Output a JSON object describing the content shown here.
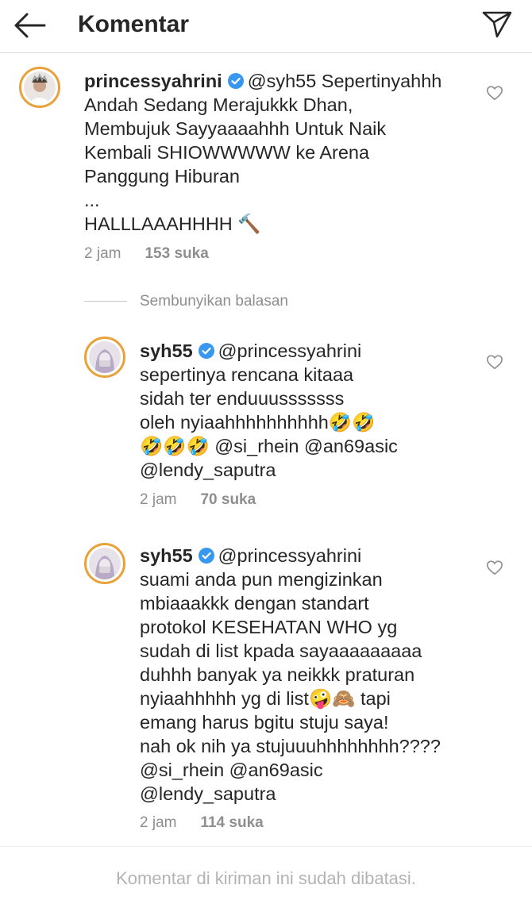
{
  "header": {
    "title": "Komentar",
    "back_icon": "arrow-left-icon",
    "share_icon": "paper-plane-icon"
  },
  "comments": [
    {
      "username": "princessyahrini",
      "verified": true,
      "lines": [
        "@syh55 Sepertinyahhh",
        "Andah Sedang Merajukkk Dhan,",
        "Membujuk Sayyaaaahhh Untuk Naik",
        "Kembali SHIOWWWWW ke Arena",
        "Panggung Hiburan",
        "...",
        "HALLLAAAHHHH 🔨"
      ],
      "time": "2 jam",
      "likes": "153 suka"
    }
  ],
  "hide_replies": {
    "label": "Sembunyikan balasan"
  },
  "replies": [
    {
      "username": "syh55",
      "verified": true,
      "lines": [
        "@princessyahrini",
        "sepertinya rencana kitaaa",
        "sidah ter enduuusssssss",
        "oleh nyiaahhhhhhhhhh🤣🤣",
        "🤣🤣🤣 @si_rhein @an69asic",
        "@lendy_saputra"
      ],
      "time": "2 jam",
      "likes": "70 suka"
    },
    {
      "username": "syh55",
      "verified": true,
      "lines": [
        "@princessyahrini",
        "suami anda pun mengizinkan",
        "mbiaaakkk dengan standart",
        "protokol KESEHATAN WHO yg",
        "sudah di list kpada sayaaaaaaaaa",
        "duhhh banyak ya neikkk praturan",
        "nyiaahhhhh yg di list🤪🙈 tapi",
        "emang harus bgitu stuju saya!",
        "nah ok nih ya stujuuuhhhhhhhh????",
        "@si_rhein @an69asic",
        "@lendy_saputra"
      ],
      "time": "2 jam",
      "likes": "114 suka"
    }
  ],
  "footer": {
    "text": "Komentar di kiriman ini sudah dibatasi."
  },
  "colors": {
    "avatar_ring": "#e8a23a",
    "verified_badge": "#3897f0",
    "muted_text": "#8e8e8e"
  }
}
